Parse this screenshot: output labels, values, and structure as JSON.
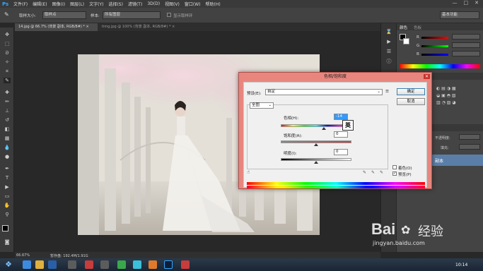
{
  "menubar": {
    "logo": "Ps",
    "items": [
      "文件(F)",
      "编辑(E)",
      "图像(I)",
      "图层(L)",
      "文字(Y)",
      "选择(S)",
      "滤镜(T)",
      "3D(D)",
      "视图(V)",
      "窗口(W)",
      "帮助(H)"
    ],
    "window_controls": [
      "—",
      "□",
      "✕"
    ]
  },
  "options_bar": {
    "sample_size_label": "取样大小:",
    "sample_size_value": "取样点",
    "sample_label": "样本:",
    "sample_value": "所有图层",
    "show_ring_label": "显示取样环",
    "workspace": "基本功能"
  },
  "tabs": [
    {
      "label": "14.jpg @ 66.7% (背景 副本, RGB/8#) *",
      "close": "×"
    },
    {
      "label": "timg.jpg @ 100% (背景 副本, RGB/8#) *",
      "close": "×"
    }
  ],
  "right_panel": {
    "tabs": [
      "颜色",
      "色板"
    ],
    "channels": [
      "R",
      "G",
      "B"
    ],
    "layers_labels": [
      "不透明度:",
      "填充:"
    ],
    "layer_name": "副本"
  },
  "status": {
    "zoom": "66.67%",
    "info": "暂存盘: 192.4M/1.91G"
  },
  "dialog": {
    "title": "色相/饱和度",
    "close": "✕",
    "preset_label": "预设(E):",
    "preset_value": "自定",
    "ok": "确定",
    "cancel": "取消",
    "channel_value": "全图",
    "hue_label": "色相(H):",
    "hue_value": "-14",
    "saturation_label": "饱和度(A):",
    "saturation_value": "0",
    "lightness_label": "明度(I):",
    "lightness_value": "0",
    "colorize_label": "着色(O)",
    "preview_label": "预览(P)",
    "preview_checked": "✓"
  },
  "ime_popup": "英",
  "taskbar": {
    "time": "10:14"
  },
  "watermark": {
    "brand": "Bai",
    "brand2": "经验",
    "url": "jingyan.baidu.com"
  }
}
